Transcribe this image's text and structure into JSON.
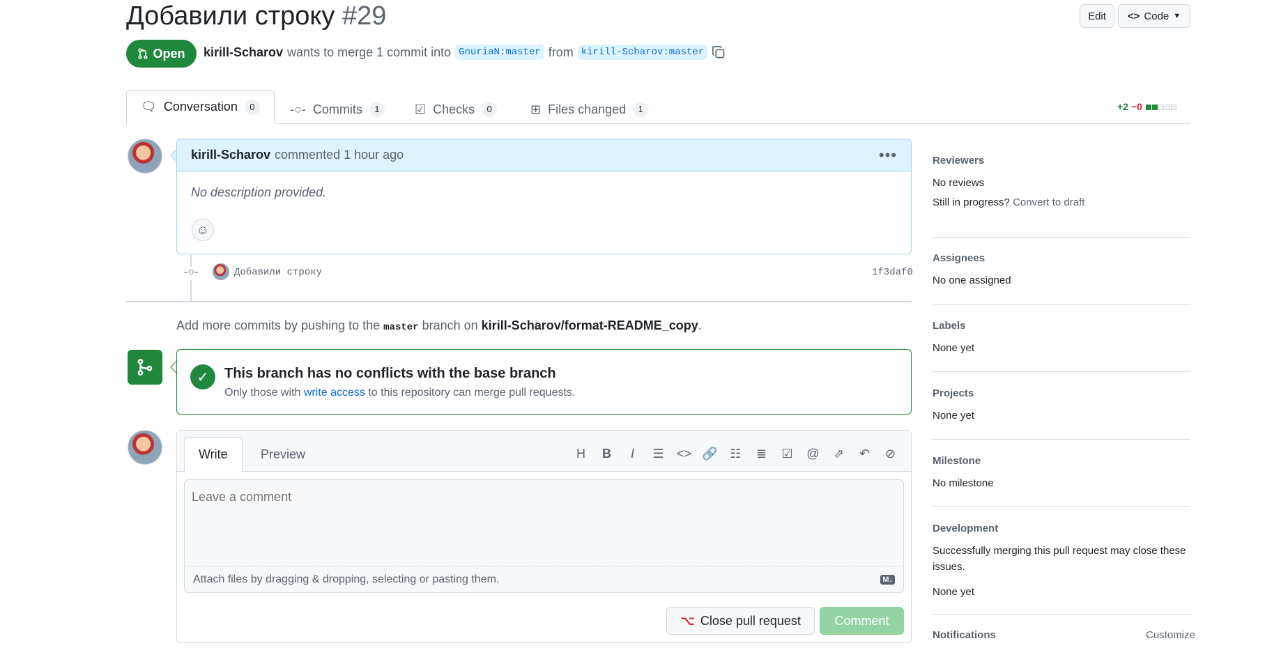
{
  "header": {
    "title": "Добавили строку",
    "number": "#29",
    "edit_label": "Edit",
    "code_label": "Code"
  },
  "status": {
    "label": "Open",
    "author": "kirill-Scharov",
    "merge_text": "wants to merge 1 commit into",
    "base_branch": "GnuriaN:master",
    "from_text": "from",
    "head_branch": "kirill-Scharov:master"
  },
  "tabs": [
    {
      "label": "Conversation",
      "count": "0"
    },
    {
      "label": "Commits",
      "count": "1"
    },
    {
      "label": "Checks",
      "count": "0"
    },
    {
      "label": "Files changed",
      "count": "1"
    }
  ],
  "diffstat": {
    "additions": "+2",
    "deletions": "−0"
  },
  "comment": {
    "author": "kirill-Scharov",
    "action": "commented 1 hour ago",
    "body": "No description provided."
  },
  "commit": {
    "message": "Добавили строку",
    "sha": "1f3daf0"
  },
  "push_hint": {
    "prefix": "Add more commits by pushing to the",
    "branch": "master",
    "middle": "branch on",
    "repo": "kirill-Scharov/format-README_copy",
    "suffix": "."
  },
  "merge": {
    "title": "This branch has no conflicts with the base branch",
    "sub_prefix": "Only those with",
    "sub_link": "write access",
    "sub_suffix": "to this repository can merge pull requests."
  },
  "editor": {
    "write_tab": "Write",
    "preview_tab": "Preview",
    "placeholder": "Leave a comment",
    "attach_text": "Attach files by dragging & dropping, selecting or pasting them.",
    "md_badge": "M↓",
    "close_label": "Close pull request",
    "comment_label": "Comment"
  },
  "sidebar": {
    "reviewers": {
      "title": "Reviewers",
      "value": "No reviews",
      "progress_q": "Still in progress?",
      "draft_link": "Convert to draft"
    },
    "assignees": {
      "title": "Assignees",
      "value": "No one assigned"
    },
    "labels": {
      "title": "Labels",
      "value": "None yet"
    },
    "projects": {
      "title": "Projects",
      "value": "None yet"
    },
    "milestone": {
      "title": "Milestone",
      "value": "No milestone"
    },
    "development": {
      "title": "Development",
      "desc": "Successfully merging this pull request may close these issues.",
      "value": "None yet"
    },
    "notifications": {
      "title": "Notifications",
      "customize": "Customize"
    }
  }
}
